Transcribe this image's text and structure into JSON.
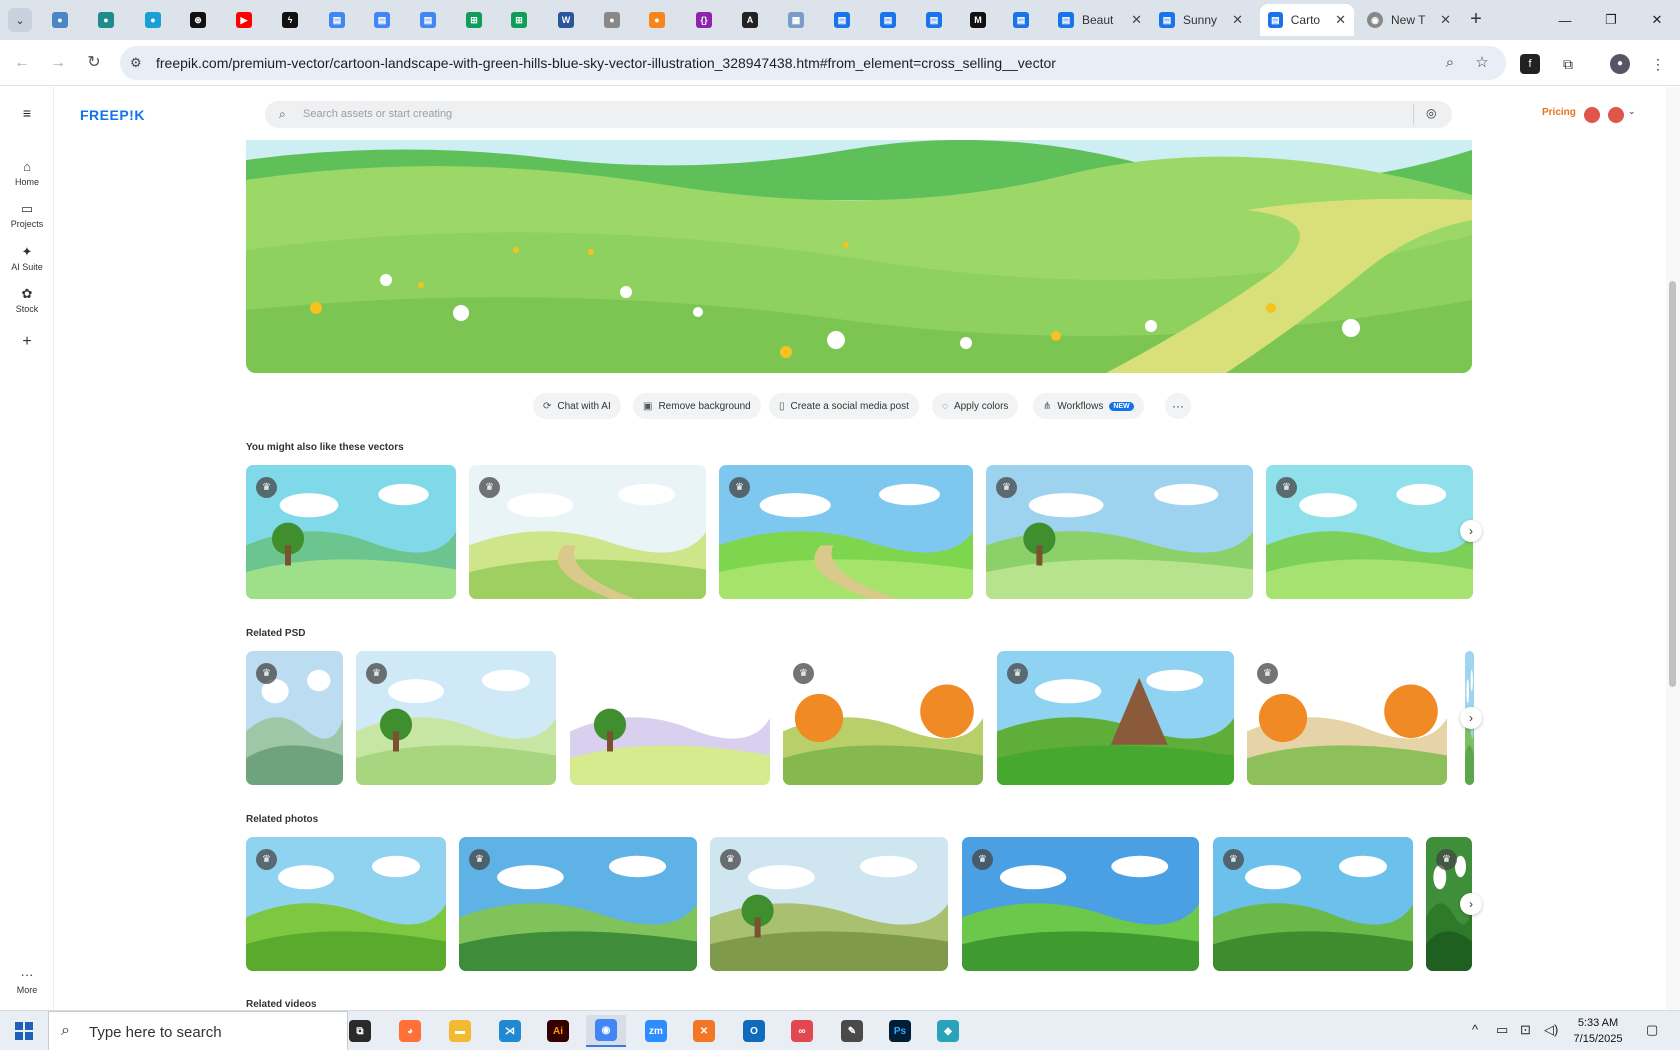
{
  "browser": {
    "pinned_tabs": [
      {
        "icon": "globe-blue-icon",
        "color": "#4a86c5"
      },
      {
        "icon": "vpn-shield-icon",
        "color": "#1e8c8c"
      },
      {
        "icon": "chevron-app-icon",
        "color": "#19a0d6"
      },
      {
        "icon": "openai-icon",
        "color": "#111111"
      },
      {
        "icon": "youtube-icon",
        "color": "#ff0000"
      },
      {
        "icon": "bolt-icon",
        "color": "#111111"
      },
      {
        "icon": "docs-icon",
        "color": "#4285f4"
      },
      {
        "icon": "docs-icon",
        "color": "#4285f4"
      },
      {
        "icon": "docs-icon",
        "color": "#4285f4"
      },
      {
        "icon": "sheets-icon",
        "color": "#0f9d58"
      },
      {
        "icon": "sheets-icon",
        "color": "#0f9d58"
      },
      {
        "icon": "word-icon",
        "color": "#2b579a"
      },
      {
        "icon": "globe-grey-icon",
        "color": "#888888"
      },
      {
        "icon": "fox-icon",
        "color": "#f6851b"
      },
      {
        "icon": "braces-icon",
        "color": "#8e24aa"
      },
      {
        "icon": "claude-icon",
        "color": "#222222"
      },
      {
        "icon": "grid-icon",
        "color": "#7b9cc7"
      },
      {
        "icon": "forms-icon",
        "color": "#1a73e8"
      },
      {
        "icon": "forms-icon",
        "color": "#1a73e8"
      },
      {
        "icon": "forms-icon",
        "color": "#1a73e8"
      },
      {
        "icon": "medium-icon",
        "color": "#111111"
      },
      {
        "icon": "forms-icon",
        "color": "#1a73e8"
      }
    ],
    "tabs": [
      {
        "title": "Beaut",
        "icon": "forms-icon"
      },
      {
        "title": "Sunny",
        "icon": "forms-icon"
      },
      {
        "title": "Carto",
        "icon": "forms-icon",
        "active": true
      },
      {
        "title": "New T",
        "icon": "chrome-icon"
      }
    ],
    "url": "freepik.com/premium-vector/cartoon-landscape-with-green-hills-blue-sky-vector-illustration_328947438.htm#from_element=cross_selling__vector"
  },
  "freepik": {
    "logo": "FREEP!K",
    "search_placeholder": "Search assets or start creating",
    "pricing": "Pricing",
    "sidebar": [
      {
        "label": "Home",
        "icon": "home-icon"
      },
      {
        "label": "Projects",
        "icon": "folder-icon"
      },
      {
        "label": "AI Suite",
        "icon": "sparkle-icon"
      },
      {
        "label": "Stock",
        "icon": "stock-icon"
      }
    ],
    "more_label": "More",
    "actions": [
      {
        "label": "Chat with AI",
        "icon": "chat-icon"
      },
      {
        "label": "Remove background",
        "icon": "remove-bg-icon"
      },
      {
        "label": "Create a social media post",
        "icon": "phone-icon"
      },
      {
        "label": "Apply colors",
        "icon": "palette-icon"
      },
      {
        "label": "Workflows",
        "icon": "workflow-icon",
        "badge": "NEW"
      }
    ],
    "sections": {
      "vectors": "You might also like these vectors",
      "psd": "Related PSD",
      "photos": "Related photos",
      "videos": "Related videos"
    }
  },
  "taskbar": {
    "search_placeholder": "Type here to search",
    "time": "5:33 AM",
    "date": "7/15/2025",
    "apps": [
      {
        "icon": "task-view-icon"
      },
      {
        "icon": "firefox-icon"
      },
      {
        "icon": "file-explorer-icon"
      },
      {
        "icon": "vscode-icon"
      },
      {
        "icon": "illustrator-icon",
        "label": "Ai"
      },
      {
        "icon": "chrome-icon"
      },
      {
        "icon": "zoom-icon",
        "label": "zm"
      },
      {
        "icon": "xampp-icon"
      },
      {
        "icon": "outlook-icon"
      },
      {
        "icon": "creative-cloud-icon"
      },
      {
        "icon": "pen-tool-icon"
      },
      {
        "icon": "photoshop-icon",
        "label": "Ps"
      },
      {
        "icon": "app-diamond-icon"
      }
    ]
  }
}
